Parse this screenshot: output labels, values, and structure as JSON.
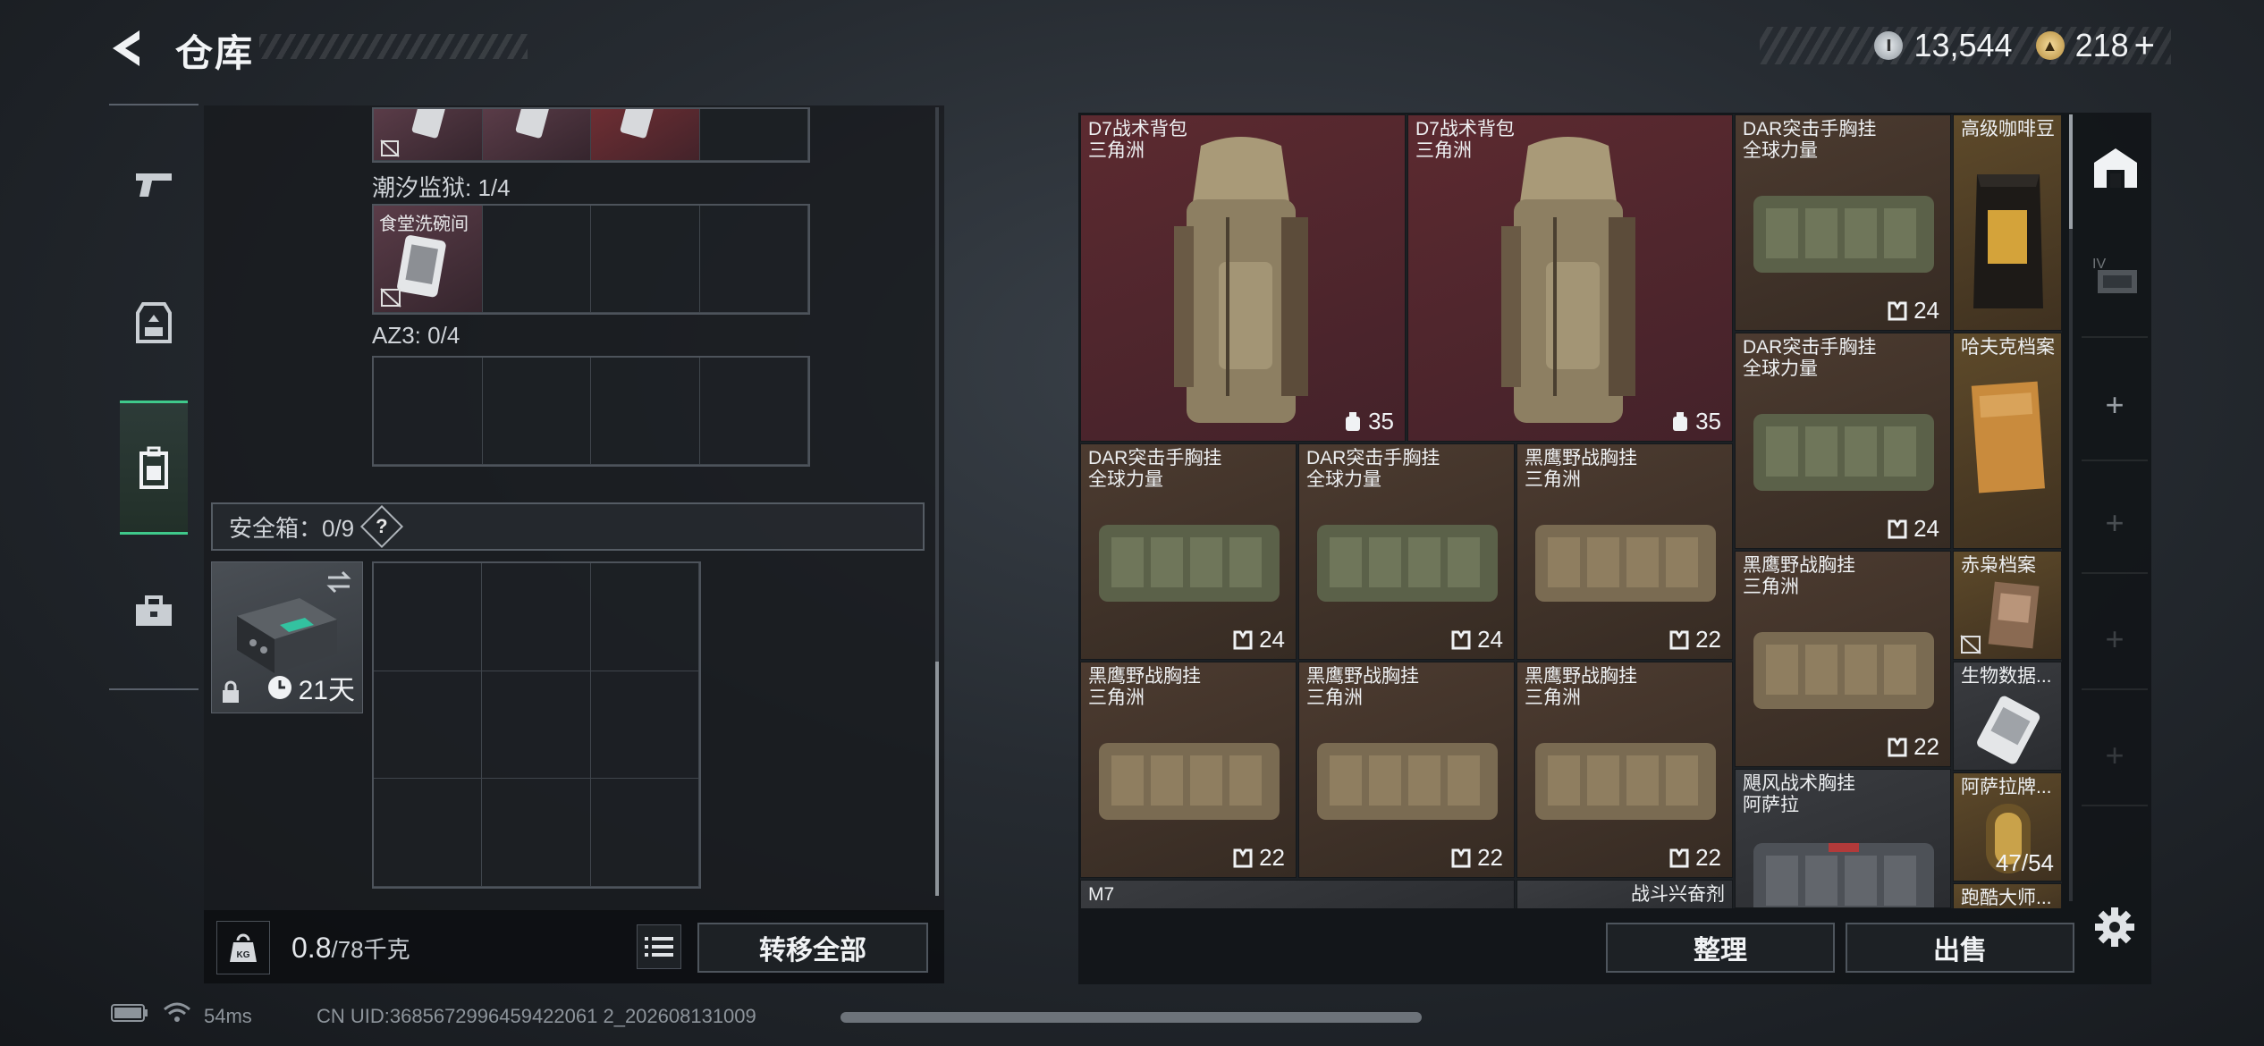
{
  "header": {
    "title": "仓库",
    "currency": [
      {
        "icon": "silver-coin-icon",
        "value": "13,544"
      },
      {
        "icon": "gold-coin-icon",
        "value": "218"
      }
    ],
    "topup_symbol": "+"
  },
  "nav": {
    "items": [
      {
        "name": "weapons",
        "icon": "pistol-icon"
      },
      {
        "name": "equipment",
        "icon": "armor-icon"
      },
      {
        "name": "backpack",
        "icon": "backpack-icon",
        "active": true
      },
      {
        "name": "toolbox",
        "icon": "toolbox-icon"
      }
    ]
  },
  "left": {
    "section1_label": "潮汐监狱: 1/4",
    "canteen_item_label": "食堂洗碗间",
    "section2_label": "AZ3: 0/4",
    "safe_label": "安全箱：0/9",
    "help": "?",
    "safebox_timer": "21天",
    "weight_current": "0.8",
    "weight_max": "/78千克",
    "transfer_all": "转移全部"
  },
  "stash": {
    "items": [
      {
        "name": "D7战术背包",
        "sub": "三角洲",
        "stat": "35"
      },
      {
        "name": "D7战术背包",
        "sub": "三角洲",
        "stat": "35"
      },
      {
        "name": "DAR突击手胸挂",
        "sub": "全球力量",
        "stat": "24"
      },
      {
        "name": "高级咖啡豆",
        "sub": "",
        "stat": ""
      },
      {
        "name": "DAR突击手胸挂",
        "sub": "全球力量",
        "stat": "24"
      },
      {
        "name": "哈夫克档案",
        "sub": "",
        "stat": ""
      },
      {
        "name": "DAR突击手胸挂",
        "sub": "全球力量",
        "stat": "24"
      },
      {
        "name": "DAR突击手胸挂",
        "sub": "全球力量",
        "stat": "24"
      },
      {
        "name": "黑鹰野战胸挂",
        "sub": "三角洲",
        "stat": "22"
      },
      {
        "name": "黑鹰野战胸挂",
        "sub": "三角洲",
        "stat": "22"
      },
      {
        "name": "赤枭档案",
        "sub": "",
        "stat": ""
      },
      {
        "name": "黑鹰野战胸挂",
        "sub": "三角洲",
        "stat": "22"
      },
      {
        "name": "黑鹰野战胸挂",
        "sub": "三角洲",
        "stat": "22"
      },
      {
        "name": "黑鹰野战胸挂",
        "sub": "三角洲",
        "stat": "22"
      },
      {
        "name": "生物数据...",
        "sub": "",
        "stat": ""
      },
      {
        "name": "飓风战术胸挂",
        "sub": "阿萨拉",
        "stat": ""
      },
      {
        "name": "阿萨拉牌...",
        "sub": "",
        "stat": "47/54"
      },
      {
        "name": "M7",
        "sub": "",
        "stat": ""
      },
      {
        "name": "战斗兴奋剂",
        "sub": "",
        "stat": ""
      },
      {
        "name": "跑酷大师...",
        "sub": "",
        "stat": ""
      }
    ],
    "sort": "整理",
    "sell": "出售"
  },
  "status": {
    "ping": "54ms",
    "uid": "CN UID:3685672996459422061 2_202608131009"
  }
}
